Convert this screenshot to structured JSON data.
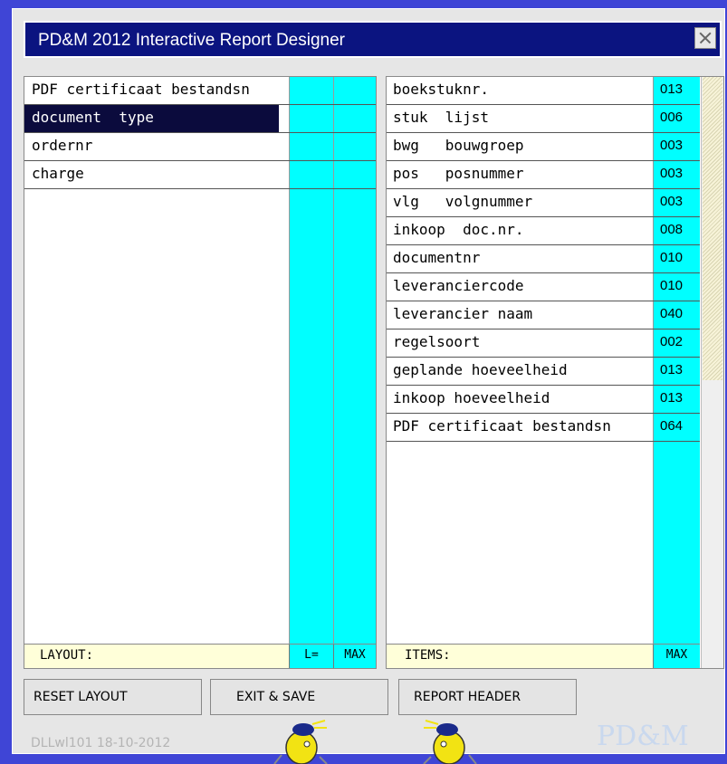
{
  "window": {
    "title": "PD&M 2012 Interactive Report Designer"
  },
  "layout": {
    "rows": [
      {
        "label": "PDF certificaat bestandsn",
        "selected": false
      },
      {
        "label": "document  type",
        "selected": true
      },
      {
        "label": "ordernr",
        "selected": false
      },
      {
        "label": "charge",
        "selected": false
      }
    ],
    "footer": {
      "label": "LAYOUT:",
      "col1": "L=",
      "col2": "MAX"
    }
  },
  "items": {
    "rows": [
      {
        "label": "boekstuknr.",
        "max": "013"
      },
      {
        "label": "stuk  lijst",
        "max": "006"
      },
      {
        "label": "bwg   bouwgroep",
        "max": "003"
      },
      {
        "label": "pos   posnummer",
        "max": "003"
      },
      {
        "label": "vlg   volgnummer",
        "max": "003"
      },
      {
        "label": "inkoop  doc.nr.",
        "max": "008"
      },
      {
        "label": "documentnr",
        "max": "010"
      },
      {
        "label": "leveranciercode",
        "max": "010"
      },
      {
        "label": "leverancier naam",
        "max": "040"
      },
      {
        "label": "regelsoort",
        "max": "002"
      },
      {
        "label": "geplande hoeveelheid",
        "max": "013"
      },
      {
        "label": "inkoop hoeveelheid",
        "max": "013"
      },
      {
        "label": "PDF certificaat bestandsn",
        "max": "064"
      }
    ],
    "footer": {
      "label": "ITEMS:",
      "col1": "MAX"
    }
  },
  "buttons": {
    "reset": "RESET LAYOUT",
    "exit": "EXIT & SAVE",
    "header": "REPORT HEADER"
  },
  "status": {
    "version": "DLLwl101 18-10-2012"
  },
  "logo": {
    "text": "PD&M"
  },
  "colors": {
    "titlebar": "#0b1480",
    "accent": "#00ffff",
    "footer": "#ffffd9",
    "selection": "#0b0b3d"
  }
}
